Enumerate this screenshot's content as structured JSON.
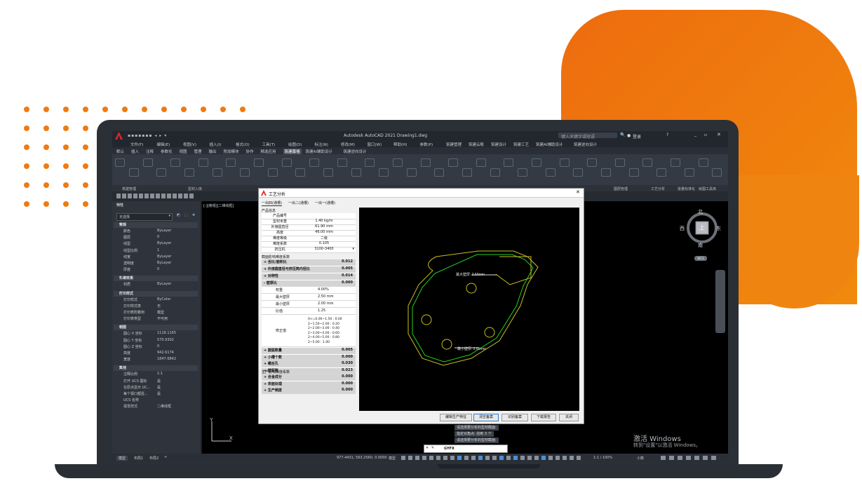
{
  "app": {
    "title": "Autodesk AutoCAD 2021   Drawing1.dwg",
    "search_placeholder": "键入关键字或短语",
    "login": "登录"
  },
  "menubar": [
    "文件(F)",
    "编辑(E)",
    "视图(V)",
    "插入(I)",
    "格式(O)",
    "工具(T)",
    "绘图(D)",
    "标注(N)",
    "修改(M)",
    "窗口(W)",
    "帮助(H)",
    "参数(P)",
    "筑建管理",
    "筑建云账",
    "筑建设计",
    "筑建工艺",
    "筑建AI辅助设计",
    "筑建逆向设计"
  ],
  "tabs": [
    "默认",
    "插入",
    "注释",
    "参数化",
    "视图",
    "管理",
    "输出",
    "附加模块",
    "协作",
    "精选应用",
    "筑建幕墙",
    "筑建AI辅助设计",
    "筑建逆向设计"
  ],
  "ribbon_groups": [
    "筑建管理",
    "型材入库",
    "图层管理",
    "工艺分析",
    "批量标准化",
    "绘图工具库"
  ],
  "properties": {
    "header": "特性",
    "selection": "无选择",
    "sections": [
      {
        "name": "常规",
        "rows": [
          [
            "颜色",
            "ByLayer"
          ],
          [
            "图层",
            "0"
          ],
          [
            "线型",
            "ByLayer"
          ],
          [
            "线型比例",
            "1"
          ],
          [
            "线宽",
            "ByLayer"
          ],
          [
            "透明度",
            "ByLayer"
          ],
          [
            "厚度",
            "0"
          ]
        ]
      },
      {
        "name": "三维效果",
        "rows": [
          [
            "材质",
            "ByLayer"
          ]
        ]
      },
      {
        "name": "打印样式",
        "rows": [
          [
            "打印样式",
            "ByColor"
          ],
          [
            "打印样式表",
            "无"
          ],
          [
            "打印表附着到",
            "模型"
          ],
          [
            "打印表类型",
            "不可用"
          ]
        ]
      },
      {
        "name": "视图",
        "rows": [
          [
            "圆心 X 坐标",
            "1118.1165"
          ],
          [
            "圆心 Y 坐标",
            "570.9302"
          ],
          [
            "圆心 Z 坐标",
            "0"
          ],
          [
            "高度",
            "942.6174"
          ],
          [
            "宽度",
            "1847.6842"
          ]
        ]
      },
      {
        "name": "其他",
        "rows": [
          [
            "注释比例",
            "1:1"
          ],
          [
            "打开 UCS 图标",
            "是"
          ],
          [
            "在原点显示 UC...",
            "是"
          ],
          [
            "每个视口都显...",
            "是"
          ],
          [
            "UCS 名称",
            ""
          ],
          [
            "视觉样式",
            "二维线框"
          ]
        ]
      }
    ]
  },
  "viewport_label": "[-][俯视][二维线框]",
  "viewcube": {
    "north": "北",
    "south": "南",
    "east": "东",
    "west": "西",
    "top": "上",
    "ucs": "WCS"
  },
  "dialog": {
    "title": "工艺分析",
    "tabs": [
      "一出四(通槽)",
      "一出二(通槽)",
      "一出一(通槽)"
    ],
    "product_info_header": "产品信息",
    "product_info": [
      [
        "产品编号",
        ""
      ],
      [
        "型材米重",
        "1.40 kg/m"
      ],
      [
        "外接圆直径",
        "61.90 mm"
      ],
      [
        "高度",
        "46.00 mm"
      ],
      [
        "难度等级",
        "二级"
      ],
      [
        "难度系数",
        "0.105"
      ],
      [
        "挤压机",
        "3100-3400"
      ]
    ],
    "section_header": "截面影响难度系数",
    "section_rows": [
      {
        "label": "+ 舌比/面积比",
        "value": "0.012",
        "group": true
      },
      {
        "label": "+ 外接圆直径与挤压筒内径比",
        "value": "0.005",
        "group": true
      },
      {
        "label": "+ 对称性",
        "value": "0.014",
        "group": true
      },
      {
        "label": "- 壁厚比",
        "value": "0.000",
        "group": true
      },
      {
        "label": "权重",
        "value": "4.00%",
        "group": false
      },
      {
        "label": "最大壁厚",
        "value": "2.50 mm",
        "group": false
      },
      {
        "label": "最小壁厚",
        "value": "2.00 mm",
        "group": false
      },
      {
        "label": "比值",
        "value": "1.25",
        "group": false
      }
    ],
    "correction_label": "修正值",
    "correction_lines": [
      "0<=0.00~1.50 : 0.00",
      "2~1.50~2.00 : 0.20",
      "2~2.00~3.00 : 0.40",
      "2~3.00~4.00 : 0.60",
      "2~4.00~5.00 : 0.80",
      "2~5.00  : 1.00"
    ],
    "section_rows2": [
      {
        "label": "+ 圆弧数量",
        "value": "0.005"
      },
      {
        "label": "+ 小槽个数",
        "value": "0.000"
      },
      {
        "label": "+ 螺丝孔",
        "value": "0.030"
      },
      {
        "label": "+ 壁距数",
        "value": "0.023"
      }
    ],
    "production_header": "生产影响难度系数",
    "production_rows": [
      {
        "label": "+ 合金成分",
        "value": "0.000"
      },
      {
        "label": "+ 表面处理",
        "value": "0.000"
      },
      {
        "label": "+ 生产频度",
        "value": "0.000"
      }
    ],
    "drawing_labels": {
      "max": "最大壁厚: 2.50mm",
      "min": "最小壁厚: 2.00mm"
    },
    "buttons": [
      "编辑生产特征",
      "清空备案",
      "识别备案",
      "下载报告",
      "关闭"
    ]
  },
  "command_history": [
    "请选择要分析的型材截面:",
    "指定对角点:  找到 3 个",
    "请选择要分析的型材截面:"
  ],
  "command_prompt": "GYFX",
  "status": {
    "layout_tabs": [
      "模型",
      "布局1",
      "布局2"
    ],
    "coords": "977.4431, 563.2560, 0.0000",
    "model": "模型",
    "scale": "1:1 / 100%",
    "unit": "小数"
  },
  "watermark": {
    "line1": "激活 Windows",
    "line2": "转到\"设置\"以激活 Windows。"
  }
}
